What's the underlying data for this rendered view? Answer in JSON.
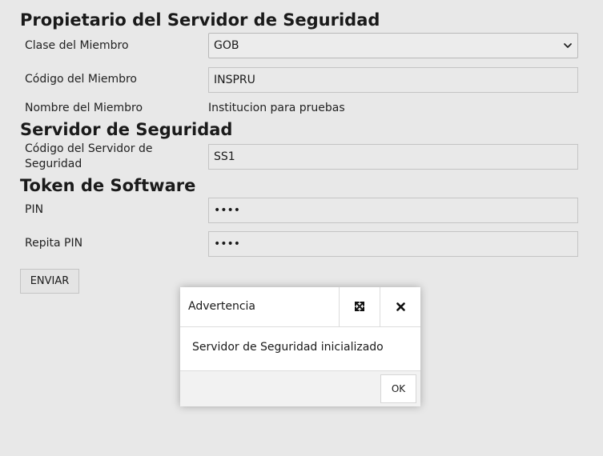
{
  "owner_section": {
    "title": "Propietario del Servidor de Seguridad",
    "member_class": {
      "label": "Clase del Miembro",
      "selected": "GOB"
    },
    "member_code": {
      "label": "Código del Miembro",
      "value": "INSPRU"
    },
    "member_name": {
      "label": "Nombre del Miembro",
      "value": "Institucion para pruebas"
    }
  },
  "server_section": {
    "title": "Servidor de Seguridad",
    "server_code": {
      "label": "Código del Servidor de Seguridad",
      "value": "SS1"
    }
  },
  "token_section": {
    "title": "Token de Software",
    "pin": {
      "label": "PIN",
      "masked": "••••"
    },
    "repeat_pin": {
      "label": "Repita PIN",
      "masked": "••••"
    }
  },
  "submit_label": "ENVIAR",
  "dialog": {
    "title": "Advertencia",
    "message": "Servidor de Seguridad inicializado",
    "ok_label": "OK",
    "maximize_icon": "expand-arrows-icon",
    "close_icon": "close-icon"
  },
  "colors": {
    "page_background": "#e8e8e8",
    "input_background": "#e9e9e9",
    "dialog_background": "#ffffff",
    "dialog_footer": "#f2f2f2"
  }
}
